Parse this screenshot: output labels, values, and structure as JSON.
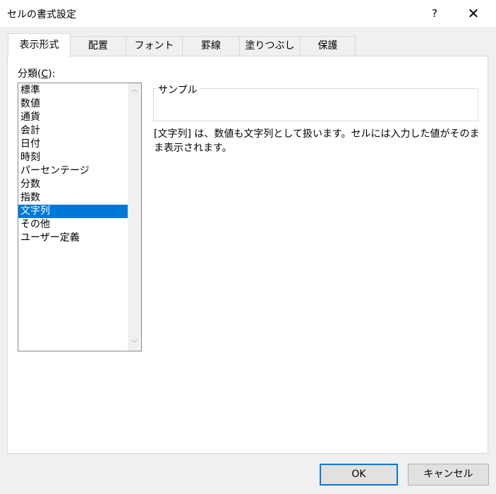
{
  "window": {
    "title": "セルの書式設定",
    "help_label": "?",
    "close_label": "✕"
  },
  "tabs": [
    {
      "label": "表示形式",
      "active": true
    },
    {
      "label": "配置",
      "active": false
    },
    {
      "label": "フォント",
      "active": false
    },
    {
      "label": "罫線",
      "active": false
    },
    {
      "label": "塗りつぶし",
      "active": false
    },
    {
      "label": "保護",
      "active": false
    }
  ],
  "category": {
    "label_prefix": "分類(",
    "label_accel": "C",
    "label_suffix": "):",
    "items": [
      "標準",
      "数値",
      "通貨",
      "会計",
      "日付",
      "時刻",
      "パーセンテージ",
      "分数",
      "指数",
      "文字列",
      "その他",
      "ユーザー定義"
    ],
    "selected": "文字列"
  },
  "sample": {
    "label": "サンプル",
    "value": ""
  },
  "description": "[文字列] は、数値も文字列として扱います。セルには入力した値がそのまま表示されます。",
  "buttons": {
    "ok_label": "OK",
    "cancel_label": "キャンセル"
  },
  "colors": {
    "selection": "#0078d7",
    "dialog_bg": "#f0f0f0",
    "panel_bg": "#ffffff"
  }
}
